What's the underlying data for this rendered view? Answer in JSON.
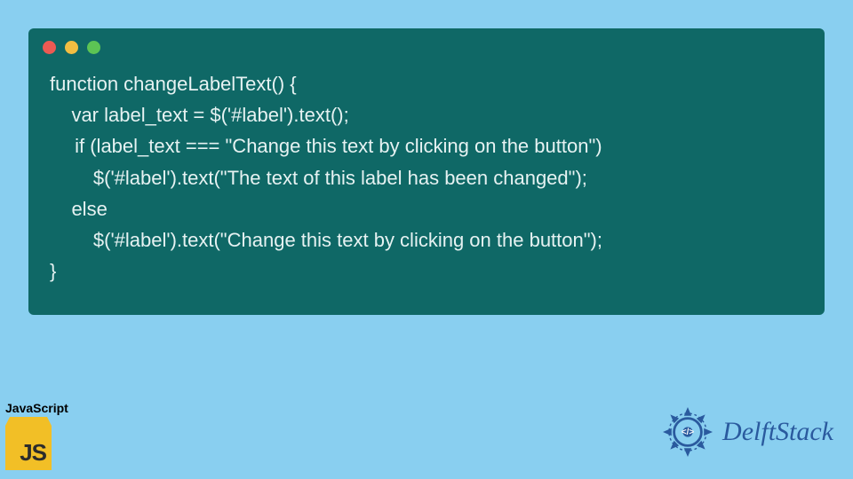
{
  "code": {
    "line1": "function changeLabelText() {",
    "line2": "    var label_text = $('#label').text();",
    "line3": "  if (label_text === \"Change this text by clicking on the button\")",
    "line4": "        $('#label').text(\"The text of this label has been changed\");",
    "line5": "    else",
    "line6": "        $('#label').text(\"Change this text by clicking on the button\");",
    "line7": "}"
  },
  "js_badge": {
    "label": "JavaScript",
    "logo_text": "JS"
  },
  "brand": {
    "name": "DelftStack"
  },
  "colors": {
    "page_bg": "#89cff0",
    "code_bg": "#0f6866",
    "code_fg": "#e6f2f2",
    "js_yellow": "#f2bf26",
    "brand_blue": "#2a5a9e"
  }
}
